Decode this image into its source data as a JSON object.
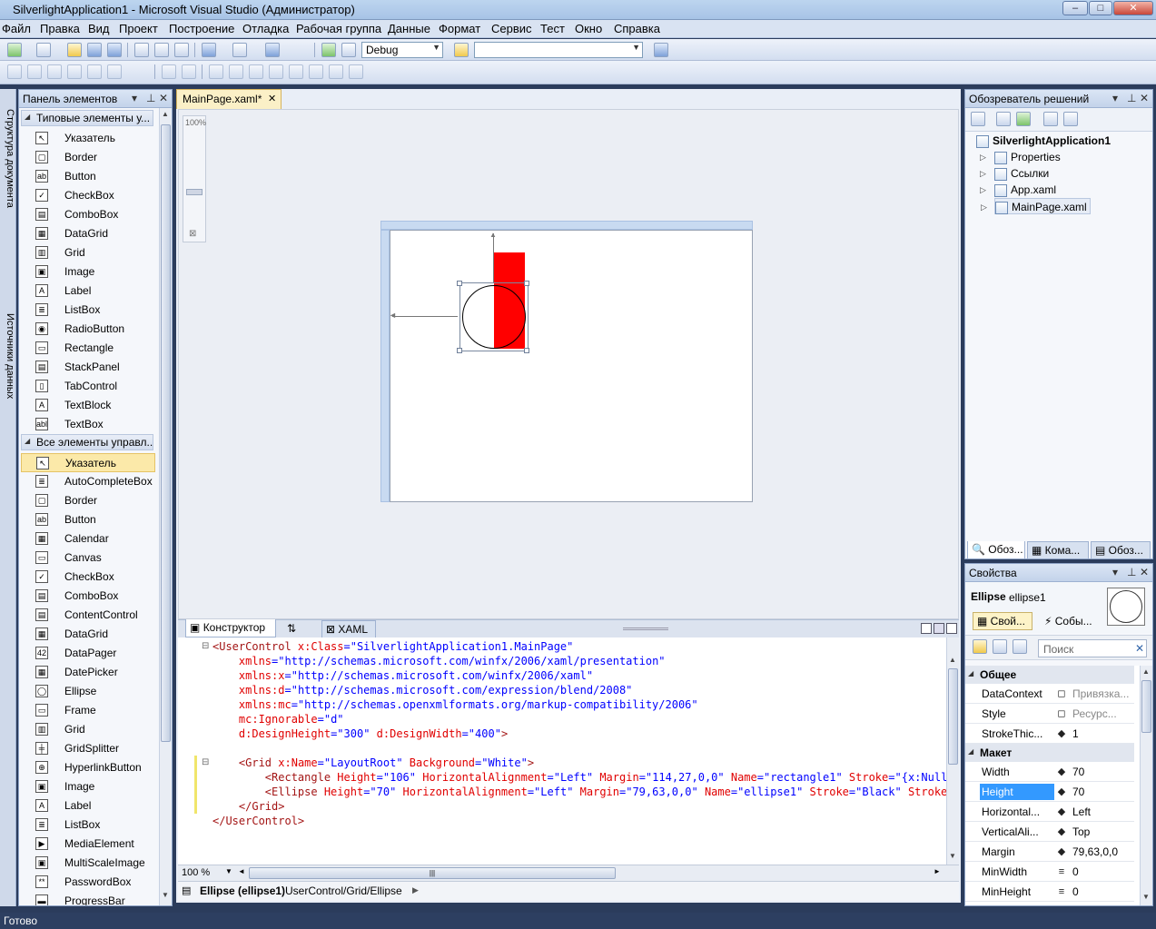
{
  "window": {
    "title": "SilverlightApplication1 - Microsoft Visual Studio (Администратор)",
    "controls": [
      "–",
      "□",
      "✕"
    ]
  },
  "menu": [
    "Файл",
    "Правка",
    "Вид",
    "Проект",
    "Построение",
    "Отладка",
    "Рабочая группа",
    "Данные",
    "Формат",
    "Сервис",
    "Тест",
    "Окно",
    "Справка"
  ],
  "toolbar": {
    "config_value": "Debug",
    "find_value": ""
  },
  "left_strip": {
    "tabs": [
      "Структура документа",
      "Источники данных"
    ]
  },
  "toolbox": {
    "title": "Панель элементов",
    "group1": {
      "label": "Типовые элементы у...",
      "items": [
        "Указатель",
        "Border",
        "Button",
        "CheckBox",
        "ComboBox",
        "DataGrid",
        "Grid",
        "Image",
        "Label",
        "ListBox",
        "RadioButton",
        "Rectangle",
        "StackPanel",
        "TabControl",
        "TextBlock",
        "TextBox"
      ]
    },
    "group2": {
      "label": "Все элементы управл...",
      "items": [
        "Указатель",
        "AutoCompleteBox",
        "Border",
        "Button",
        "Calendar",
        "Canvas",
        "CheckBox",
        "ComboBox",
        "ContentControl",
        "DataGrid",
        "DataPager",
        "DatePicker",
        "Ellipse",
        "Frame",
        "Grid",
        "GridSplitter",
        "HyperlinkButton",
        "Image",
        "Label",
        "ListBox",
        "MediaElement",
        "MultiScaleImage",
        "PasswordBox",
        "ProgressBar"
      ]
    },
    "icons": {
      "Указатель": "↖",
      "Border": "▢",
      "Button": "ab",
      "CheckBox": "✓",
      "ComboBox": "▤",
      "DataGrid": "▦",
      "Grid": "▥",
      "Image": "▣",
      "Label": "A",
      "ListBox": "≣",
      "RadioButton": "◉",
      "Rectangle": "▭",
      "StackPanel": "▤",
      "TabControl": "▯",
      "TextBlock": "A",
      "TextBox": "abl",
      "AutoCompleteBox": "≣",
      "Calendar": "▦",
      "Canvas": "▭",
      "ContentControl": "▤",
      "DataPager": "42",
      "DatePicker": "▦",
      "Ellipse": "◯",
      "Frame": "▭",
      "GridSplitter": "╪",
      "HyperlinkButton": "⊕",
      "MediaElement": "▶",
      "MultiScaleImage": "▣",
      "PasswordBox": "**",
      "ProgressBar": "▬"
    }
  },
  "document": {
    "tab_label": "MainPage.xaml*",
    "zoom_label": "100%",
    "split": {
      "designer_tab": "Конструктор",
      "xaml_tab": "XAML",
      "swap_label": "⇅"
    },
    "xaml_lines": [
      {
        "indent": 0,
        "parts": [
          [
            "t",
            "<UserControl "
          ],
          [
            "a",
            "x:Class"
          ],
          [
            "p",
            "=\""
          ],
          [
            "v",
            "SilverlightApplication1.MainPage"
          ],
          [
            "p",
            "\""
          ]
        ]
      },
      {
        "indent": 4,
        "parts": [
          [
            "a",
            "xmlns"
          ],
          [
            "p",
            "=\""
          ],
          [
            "v",
            "http://schemas.microsoft.com/winfx/2006/xaml/presentation"
          ],
          [
            "p",
            "\""
          ]
        ]
      },
      {
        "indent": 4,
        "parts": [
          [
            "a",
            "xmlns:x"
          ],
          [
            "p",
            "=\""
          ],
          [
            "v",
            "http://schemas.microsoft.com/winfx/2006/xaml"
          ],
          [
            "p",
            "\""
          ]
        ]
      },
      {
        "indent": 4,
        "parts": [
          [
            "a",
            "xmlns:d"
          ],
          [
            "p",
            "=\""
          ],
          [
            "v",
            "http://schemas.microsoft.com/expression/blend/2008"
          ],
          [
            "p",
            "\""
          ]
        ]
      },
      {
        "indent": 4,
        "parts": [
          [
            "a",
            "xmlns:mc"
          ],
          [
            "p",
            "=\""
          ],
          [
            "v",
            "http://schemas.openxmlformats.org/markup-compatibility/2006"
          ],
          [
            "p",
            "\""
          ]
        ]
      },
      {
        "indent": 4,
        "parts": [
          [
            "a",
            "mc:Ignorable"
          ],
          [
            "p",
            "=\""
          ],
          [
            "v",
            "d"
          ],
          [
            "p",
            "\""
          ]
        ]
      },
      {
        "indent": 4,
        "parts": [
          [
            "a",
            "d:DesignHeight"
          ],
          [
            "p",
            "=\""
          ],
          [
            "v",
            "300"
          ],
          [
            "p",
            "\" "
          ],
          [
            "a",
            "d:DesignWidth"
          ],
          [
            "p",
            "=\""
          ],
          [
            "v",
            "400"
          ],
          [
            "p",
            "\""
          ],
          [
            "t",
            ">"
          ]
        ]
      },
      {
        "indent": 0,
        "parts": []
      },
      {
        "indent": 4,
        "parts": [
          [
            "t",
            "<Grid "
          ],
          [
            "a",
            "x:Name"
          ],
          [
            "p",
            "=\""
          ],
          [
            "v",
            "LayoutRoot"
          ],
          [
            "p",
            "\" "
          ],
          [
            "a",
            "Background"
          ],
          [
            "p",
            "=\""
          ],
          [
            "v",
            "White"
          ],
          [
            "p",
            "\""
          ],
          [
            "t",
            ">"
          ]
        ]
      },
      {
        "indent": 8,
        "parts": [
          [
            "t",
            "<Rectangle "
          ],
          [
            "a",
            "Height"
          ],
          [
            "p",
            "=\""
          ],
          [
            "v",
            "106"
          ],
          [
            "p",
            "\" "
          ],
          [
            "a",
            "HorizontalAlignment"
          ],
          [
            "p",
            "=\""
          ],
          [
            "v",
            "Left"
          ],
          [
            "p",
            "\" "
          ],
          [
            "a",
            "Margin"
          ],
          [
            "p",
            "=\""
          ],
          [
            "v",
            "114,27,0,0"
          ],
          [
            "p",
            "\" "
          ],
          [
            "a",
            "Name"
          ],
          [
            "p",
            "=\""
          ],
          [
            "v",
            "rectangle1"
          ],
          [
            "p",
            "\" "
          ],
          [
            "a",
            "Stroke"
          ],
          [
            "p",
            "=\""
          ],
          [
            "v",
            "{x:Null}"
          ],
          [
            "p",
            "\" S"
          ]
        ]
      },
      {
        "indent": 8,
        "parts": [
          [
            "t",
            "<Ellipse "
          ],
          [
            "a",
            "Height"
          ],
          [
            "p",
            "=\""
          ],
          [
            "v",
            "70"
          ],
          [
            "p",
            "\" "
          ],
          [
            "a",
            "HorizontalAlignment"
          ],
          [
            "p",
            "=\""
          ],
          [
            "v",
            "Left"
          ],
          [
            "p",
            "\" "
          ],
          [
            "a",
            "Margin"
          ],
          [
            "p",
            "=\""
          ],
          [
            "v",
            "79,63,0,0"
          ],
          [
            "p",
            "\" "
          ],
          [
            "a",
            "Name"
          ],
          [
            "p",
            "=\""
          ],
          [
            "v",
            "ellipse1"
          ],
          [
            "p",
            "\" "
          ],
          [
            "a",
            "Stroke"
          ],
          [
            "p",
            "=\""
          ],
          [
            "v",
            "Black"
          ],
          [
            "p",
            "\" "
          ],
          [
            "a",
            "StrokeThic"
          ]
        ]
      },
      {
        "indent": 4,
        "parts": [
          [
            "t",
            "</Grid>"
          ]
        ]
      },
      {
        "indent": 0,
        "parts": [
          [
            "t",
            "</UserControl>"
          ]
        ]
      }
    ],
    "code_zoom": "100 %",
    "breadcrumb_bold": "Ellipse (ellipse1)",
    "breadcrumb_path": "UserControl/Grid/Ellipse",
    "colors": {
      "rect_fill": "#ff0000"
    }
  },
  "solution": {
    "title": "Обозреватель решений",
    "root": "SilverlightApplication1",
    "items": [
      "Properties",
      "Ссылки",
      "App.xaml",
      "MainPage.xaml"
    ],
    "bottom_tabs": [
      "Обоз...",
      "Кома...",
      "Обоз..."
    ]
  },
  "properties": {
    "title": "Свойства",
    "element_type": "Ellipse",
    "element_name": "ellipse1",
    "tabs": [
      "Свой...",
      "Собы..."
    ],
    "search_placeholder": "Поиск",
    "cat1": "Общее",
    "cat2": "Макет",
    "rows1": [
      {
        "name": "DataContext",
        "icon": "◻",
        "value": "Привязка..."
      },
      {
        "name": "Style",
        "icon": "◻",
        "value": "Ресурс..."
      },
      {
        "name": "StrokeThic...",
        "icon": "◆",
        "value": "1"
      }
    ],
    "rows2": [
      {
        "name": "Width",
        "icon": "◆",
        "value": "70"
      },
      {
        "name": "Height",
        "icon": "◆",
        "value": "70"
      },
      {
        "name": "Horizontal...",
        "icon": "◆",
        "value": "Left"
      },
      {
        "name": "VerticalAli...",
        "icon": "◆",
        "value": "Top"
      },
      {
        "name": "Margin",
        "icon": "◆",
        "value": "79,63,0,0"
      },
      {
        "name": "MinWidth",
        "icon": "≡",
        "value": "0"
      },
      {
        "name": "MinHeight",
        "icon": "≡",
        "value": "0"
      }
    ]
  },
  "status": {
    "text": "Готово"
  }
}
